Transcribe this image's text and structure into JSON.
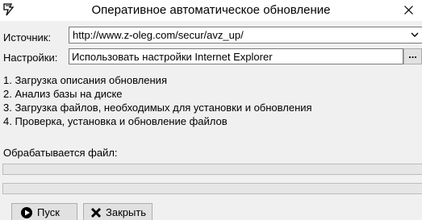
{
  "window": {
    "title": "Оперативное автоматическое обновление"
  },
  "source": {
    "label": "Источник:",
    "value": "http://www.z-oleg.com/secur/avz_up/"
  },
  "settings": {
    "label": "Настройки:",
    "value": "Использовать настройки Internet Explorer",
    "browse_label": "..."
  },
  "steps": [
    "1. Загрузка описания обновления",
    "2. Анализ базы на диске",
    "3. Загрузка файлов, необходимых для установки и обновления",
    "4. Проверка, установка и обновление файлов"
  ],
  "processing": {
    "label": "Обрабатывается файл:",
    "file_progress": 0,
    "total_progress": 0
  },
  "buttons": {
    "start_label": "Пуск",
    "close_label": "Закрыть"
  },
  "colors": {
    "window_bg": "#f0f0f0",
    "titlebar_bg": "#ffffff",
    "progress_fill": "#06b025"
  },
  "icons": {
    "app": "avz-app-icon",
    "close": "close-icon",
    "dropdown": "chevron-down-icon",
    "start": "play-icon",
    "exit": "x-icon"
  }
}
